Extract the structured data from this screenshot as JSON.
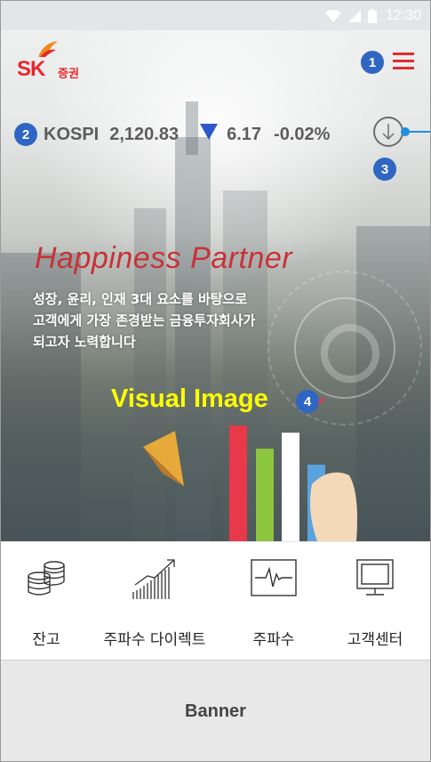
{
  "status_bar": {
    "time": "12:30",
    "icons": [
      "wifi-icon",
      "signal-icon",
      "battery-icon"
    ]
  },
  "header": {
    "brand_mark": "SK",
    "brand_text": "증권",
    "menu_icon": "hamburger-icon"
  },
  "ticker": {
    "index_name": "KOSPI",
    "index_value": "2,120.83",
    "direction": "down",
    "change": "6.17",
    "change_pct": "-0.02%"
  },
  "download_button": {
    "icon": "arrow-down-icon"
  },
  "hero": {
    "headline": "Happiness Partner",
    "subcopy": [
      "성장, 윤리, 인재 3대 요소를 바탕으로",
      "고객에게 가장 존경받는 금융투자회사가",
      "되고자 노력합니다"
    ],
    "visual_label": "Visual Image"
  },
  "annotations": {
    "menu": "1",
    "ticker": "2",
    "download": "3",
    "visual": "4"
  },
  "menu_bar": {
    "items": [
      {
        "label": "잔고",
        "icon": "coins-icon"
      },
      {
        "label": "주파수 다이렉트",
        "icon": "bar-chart-icon"
      },
      {
        "label": "주파수",
        "icon": "pulse-monitor-icon"
      },
      {
        "label": "고객센터",
        "icon": "computer-monitor-icon"
      }
    ]
  },
  "banner": {
    "label": "Banner"
  },
  "colors": {
    "brand_red": "#e8282b",
    "badge_blue": "#2f66c4",
    "down_blue": "#2e58c9",
    "visual_yellow": "#ffff00"
  }
}
